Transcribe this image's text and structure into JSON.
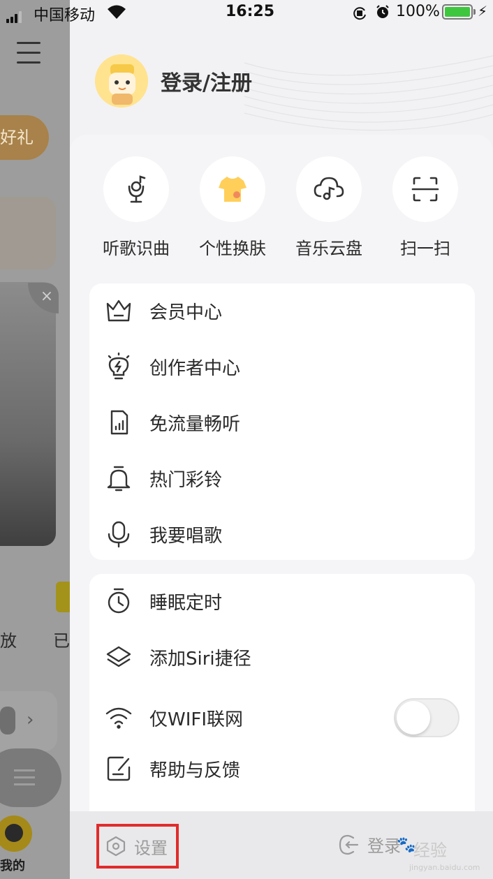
{
  "status_bar": {
    "carrier": "中国移动",
    "time": "16:25",
    "battery_percent": "100%",
    "battery_level": 1.0
  },
  "background_app": {
    "gift_button": "换好礼",
    "label_play": "放",
    "label_done": "已",
    "tab_mine": "我的"
  },
  "drawer": {
    "profile": {
      "login_register": "登录/注册"
    },
    "quick_actions": [
      {
        "label": "听歌识曲",
        "icon": "music-recognition-icon"
      },
      {
        "label": "个性换肤",
        "icon": "tshirt-skin-icon"
      },
      {
        "label": "音乐云盘",
        "icon": "cloud-music-icon"
      },
      {
        "label": "扫一扫",
        "icon": "scan-icon"
      }
    ],
    "menu_group1": [
      {
        "label": "会员中心",
        "icon": "crown-icon"
      },
      {
        "label": "创作者中心",
        "icon": "lightbulb-icon"
      },
      {
        "label": "免流量畅听",
        "icon": "sim-card-icon"
      },
      {
        "label": "热门彩铃",
        "icon": "bell-icon"
      },
      {
        "label": "我要唱歌",
        "icon": "microphone-icon"
      }
    ],
    "menu_group2": [
      {
        "label": "睡眠定时",
        "icon": "timer-icon"
      },
      {
        "label": "添加Siri捷径",
        "icon": "layers-icon"
      },
      {
        "label": "仅WIFI联网",
        "icon": "wifi-icon",
        "toggle_on": false
      },
      {
        "label": "帮助与反馈",
        "icon": "feedback-icon"
      }
    ],
    "bottom": {
      "settings": "设置",
      "login": "登录"
    }
  },
  "watermark": {
    "text": "经验",
    "url": "jingyan.baidu.com"
  },
  "colors": {
    "accent_yellow": "#ffd34d",
    "highlight_red": "#e12b2b",
    "toggle_off": "#f0f0f0",
    "battery_green": "#3fc63f"
  }
}
